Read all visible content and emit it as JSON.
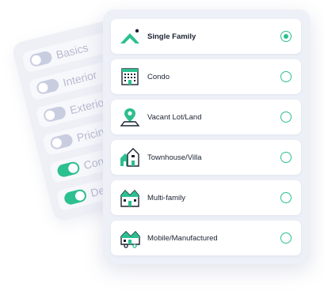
{
  "back_card": {
    "rows": [
      {
        "label": "Basics",
        "toggle": "off"
      },
      {
        "label": "Interior",
        "toggle": "off"
      },
      {
        "label": "Exterior",
        "toggle": "off"
      },
      {
        "label": "Pricing",
        "toggle": "off"
      },
      {
        "label": "Conta",
        "toggle": "on"
      },
      {
        "label": "Det",
        "toggle": "on"
      }
    ]
  },
  "property_types": {
    "options": [
      {
        "label": "Single Family",
        "icon": "single-family-house-icon",
        "selected": true
      },
      {
        "label": "Condo",
        "icon": "condo-building-icon",
        "selected": false
      },
      {
        "label": "Vacant Lot/Land",
        "icon": "map-pin-land-icon",
        "selected": false
      },
      {
        "label": "Townhouse/Villa",
        "icon": "townhouse-icon",
        "selected": false
      },
      {
        "label": "Multi-family",
        "icon": "multi-family-icon",
        "selected": false
      },
      {
        "label": "Mobile/Manufactured",
        "icon": "mobile-home-icon",
        "selected": false
      }
    ]
  },
  "colors": {
    "accent": "#2cbf8f",
    "icon_dark": "#1c2333",
    "toggle_off": "#c9cde0",
    "card_bg": "#eef0f7"
  }
}
